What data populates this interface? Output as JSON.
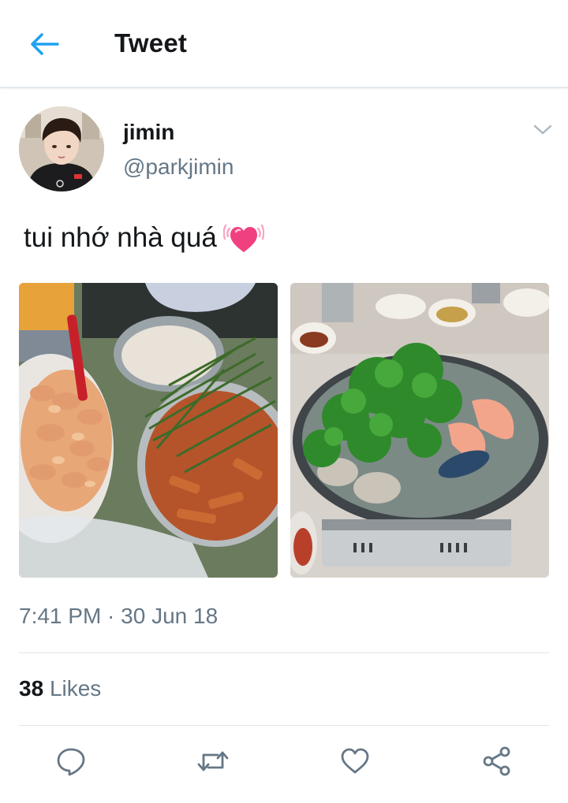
{
  "header": {
    "title": "Tweet",
    "back_icon": "arrow-left-icon",
    "accent": "#1da1f2"
  },
  "tweet": {
    "display_name": "jimin",
    "handle": "@parkjimin",
    "text": "tui nhớ nhà quá",
    "emoji": "💓",
    "timestamp": "7:41 PM · 30 Jun 18",
    "likes_count": "38",
    "likes_label": "Likes",
    "menu_icon": "chevron-down-icon"
  },
  "media": [
    {
      "description_icon": "photo-street-food"
    },
    {
      "description_icon": "photo-seafood-hotpot"
    }
  ],
  "actions": [
    {
      "name": "reply",
      "icon": "comment-icon"
    },
    {
      "name": "retweet",
      "icon": "retweet-icon"
    },
    {
      "name": "like",
      "icon": "heart-icon"
    },
    {
      "name": "share",
      "icon": "share-icon"
    }
  ],
  "colors": {
    "text_primary": "#14171a",
    "text_secondary": "#657786",
    "divider": "#e1e8ed",
    "icon": "#657786"
  }
}
